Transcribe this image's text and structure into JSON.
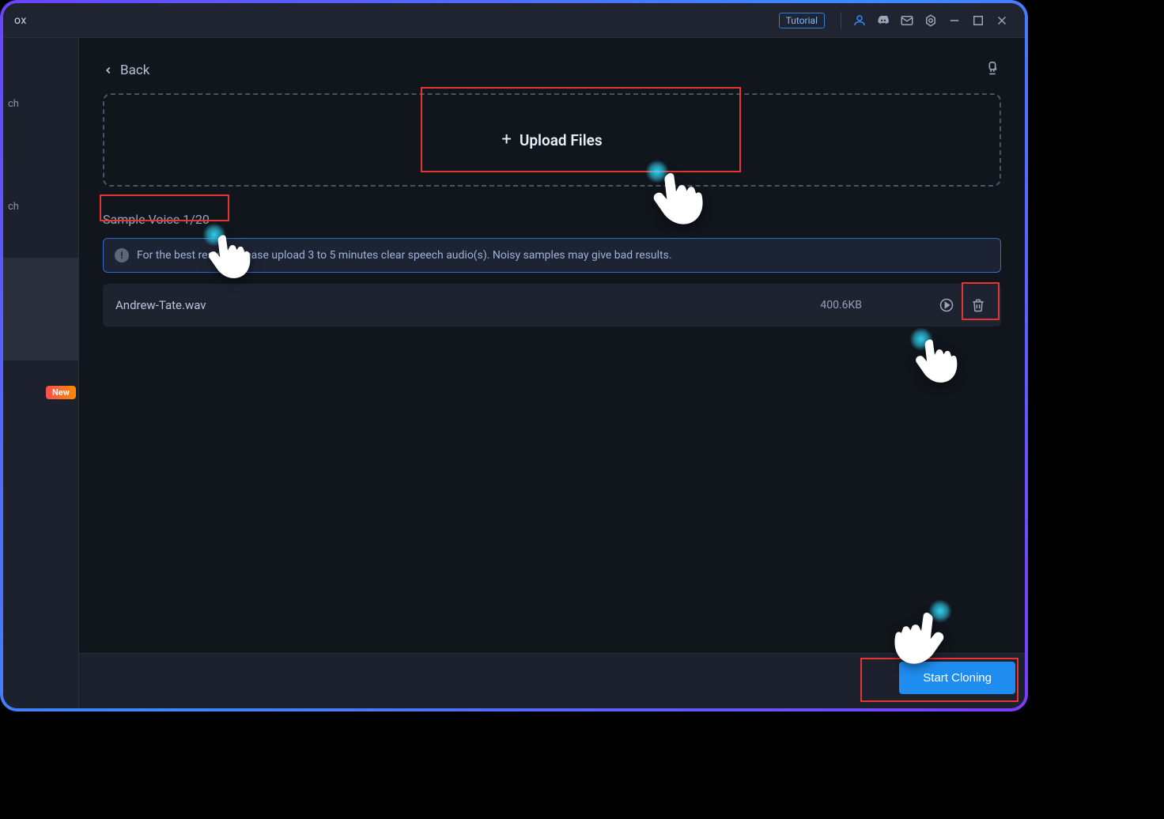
{
  "titlebar": {
    "app_suffix": "ox",
    "tutorial_label": "Tutorial"
  },
  "sidebar": {
    "item_fragment": "ch",
    "new_badge": "New"
  },
  "back_label": "Back",
  "upload": {
    "label": "Upload Files"
  },
  "sample_heading": "Sample Voice 1/20",
  "info_text": "For the best results, please upload 3 to 5 minutes clear speech audio(s). Noisy samples may give bad results.",
  "file": {
    "name": "Andrew-Tate.wav",
    "size": "400.6KB"
  },
  "start_label": "Start Cloning"
}
